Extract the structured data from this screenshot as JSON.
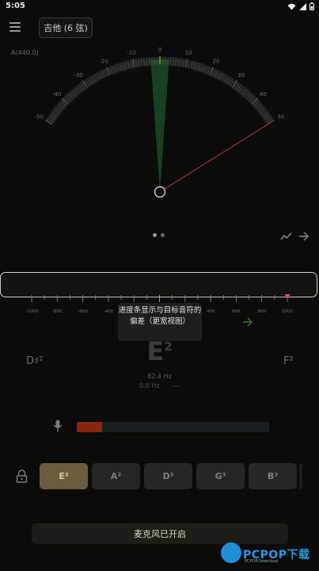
{
  "status_bar": {
    "time": "5:05",
    "icons": [
      "wifi-icon",
      "signal-icon",
      "battery-icon"
    ]
  },
  "header": {
    "instrument_label": "吉他 (6 弦)"
  },
  "tuner": {
    "reference": "A(440.0)",
    "gauge_ticks": [
      "-50",
      "-40",
      "-30",
      "-20",
      "-10",
      "0",
      "10",
      "20",
      "30",
      "40",
      "50"
    ],
    "needle_cents": 50,
    "colors": {
      "in_tune_zone": "#1d4a28",
      "needle": "#a23a44"
    }
  },
  "pager": {
    "pages": 2,
    "active": 0
  },
  "progress": {
    "scale": [
      "-1000",
      "-800",
      "-600",
      "-400",
      "-200",
      "0",
      "200",
      "400",
      "600",
      "800",
      "1000"
    ],
    "marker_value": 1000,
    "tooltip": "进度条显示与目标音符的偏差（更宽视图）"
  },
  "note": {
    "current": "E",
    "current_octave": "2",
    "prev": "D♯²",
    "next": "F²",
    "target_freq": "82.4 Hz",
    "detected_freq": "0.0 Hz",
    "detected_extra": "----"
  },
  "mic_level": 0.13,
  "strings": [
    {
      "label": "E²",
      "active": true
    },
    {
      "label": "A²",
      "active": false
    },
    {
      "label": "D³",
      "active": false
    },
    {
      "label": "G³",
      "active": false
    },
    {
      "label": "B³",
      "active": false
    }
  ],
  "banner": {
    "text": "麦克风已开启"
  },
  "watermark": {
    "brand": "PCPOP下载",
    "sub": "PCPOP.Download"
  }
}
